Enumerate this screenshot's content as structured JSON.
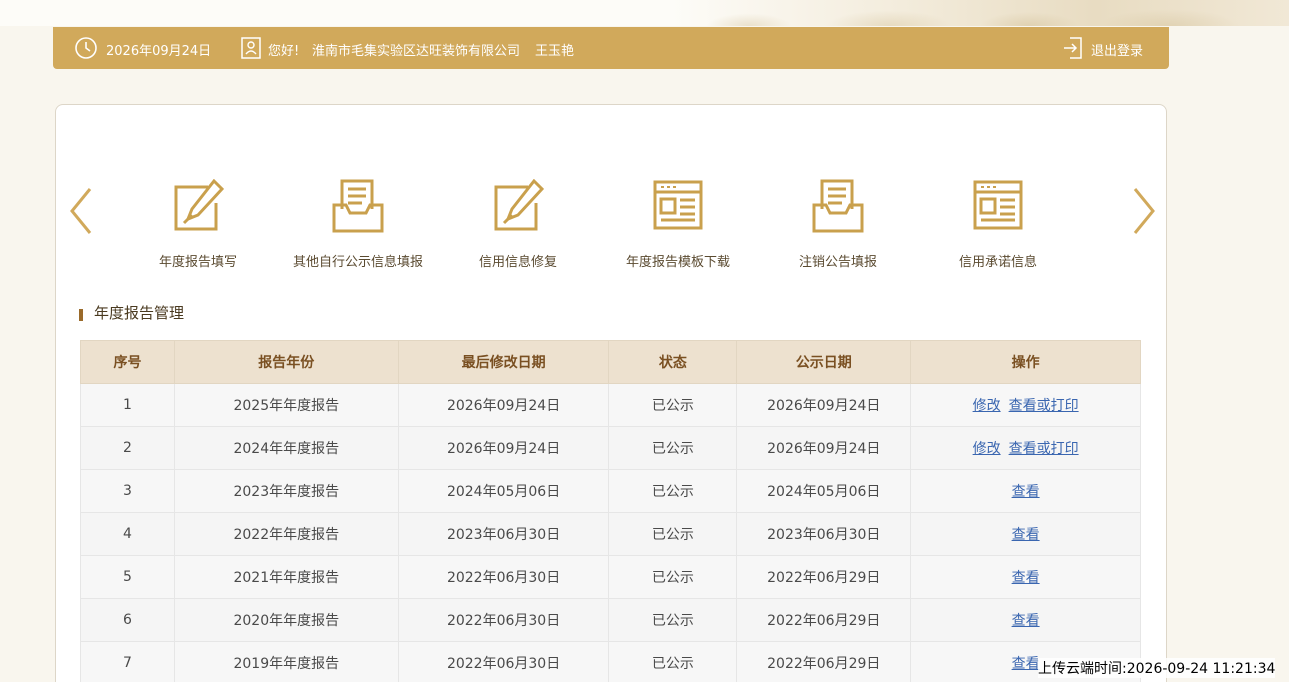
{
  "header": {
    "date": "2026年09月24日",
    "greeting": "您好!",
    "company": "淮南市毛集实验区达旺装饰有限公司",
    "person": "王玉艳",
    "logout": "退出登录"
  },
  "shortcuts": [
    {
      "label": "年度报告填写",
      "icon": "edit-icon"
    },
    {
      "label": "其他自行公示信息填报",
      "icon": "inbox-icon"
    },
    {
      "label": "信用信息修复",
      "icon": "edit-icon"
    },
    {
      "label": "年度报告模板下载",
      "icon": "template-icon"
    },
    {
      "label": "注销公告填报",
      "icon": "inbox-icon"
    },
    {
      "label": "信用承诺信息",
      "icon": "template-icon"
    }
  ],
  "section": {
    "title": "年度报告管理"
  },
  "table": {
    "headers": [
      "序号",
      "报告年份",
      "最后修改日期",
      "状态",
      "公示日期",
      "操作"
    ],
    "rows": [
      {
        "no": "1",
        "year": "2025年年度报告",
        "modified": "2026年09月24日",
        "status": "已公示",
        "published": "2026年09月24日",
        "ops": [
          "修改",
          "查看或打印"
        ]
      },
      {
        "no": "2",
        "year": "2024年年度报告",
        "modified": "2026年09月24日",
        "status": "已公示",
        "published": "2026年09月24日",
        "ops": [
          "修改",
          "查看或打印"
        ]
      },
      {
        "no": "3",
        "year": "2023年年度报告",
        "modified": "2024年05月06日",
        "status": "已公示",
        "published": "2024年05月06日",
        "ops": [
          "查看"
        ]
      },
      {
        "no": "4",
        "year": "2022年年度报告",
        "modified": "2023年06月30日",
        "status": "已公示",
        "published": "2023年06月30日",
        "ops": [
          "查看"
        ]
      },
      {
        "no": "5",
        "year": "2021年年度报告",
        "modified": "2022年06月30日",
        "status": "已公示",
        "published": "2022年06月29日",
        "ops": [
          "查看"
        ]
      },
      {
        "no": "6",
        "year": "2020年年度报告",
        "modified": "2022年06月30日",
        "status": "已公示",
        "published": "2022年06月29日",
        "ops": [
          "查看"
        ]
      },
      {
        "no": "7",
        "year": "2019年年度报告",
        "modified": "2022年06月30日",
        "status": "已公示",
        "published": "2022年06月29日",
        "ops": [
          "查看"
        ]
      }
    ]
  },
  "footer": {
    "stamp": "上传云端时间:2026-09-24 11:21:34"
  },
  "colors": {
    "accent": "#d1a95b",
    "header_text": "#ffffff",
    "table_header_bg": "#ede1cf",
    "link": "#3a66b0"
  }
}
